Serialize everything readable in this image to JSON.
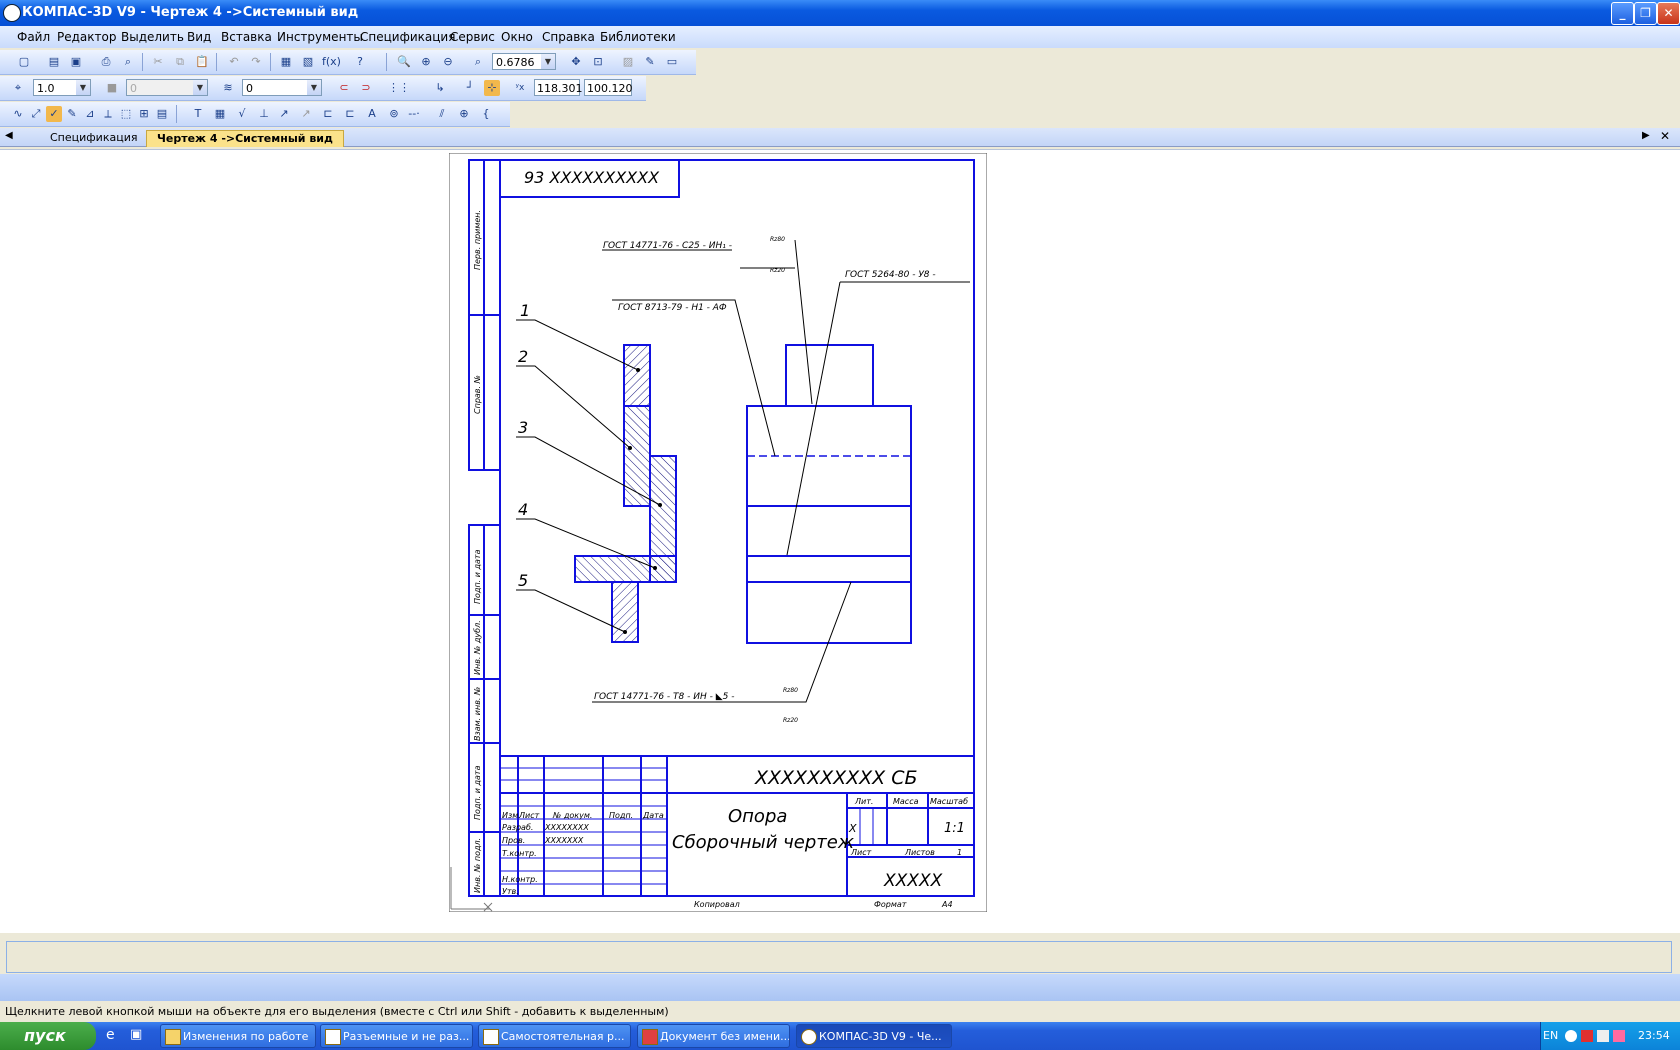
{
  "window": {
    "title": "КОМПАС-3D V9 - Чертеж 4 ->Системный вид"
  },
  "menu": [
    "Файл",
    "Редактор",
    "Выделить",
    "Вид",
    "Вставка",
    "Инструменты",
    "Спецификация",
    "Сервис",
    "Окно",
    "Справка",
    "Библиотеки"
  ],
  "toolbar1": {
    "zoom_value": "0.6786"
  },
  "toolbar2": {
    "step_value": "1.0",
    "style_value": "0",
    "layer_value": "0",
    "coord_x": "118.301",
    "coord_y": "100.120"
  },
  "tabs": [
    {
      "label": "Спецификация",
      "active": false
    },
    {
      "label": "Чертеж 4 ->Системный вид",
      "active": true
    }
  ],
  "drawing": {
    "top_stamp": "93 XXXXXXXXXX",
    "margin_labels": [
      "Перв. примен.",
      "Справ. №",
      "Подп. и дата",
      "Инв. № дубл.",
      "Взам. инв. №",
      "Подп. и дата",
      "Инв. № подл."
    ],
    "callouts": [
      "1",
      "2",
      "3",
      "4",
      "5"
    ],
    "annotation_1": "ГОСТ 14771-76 - С25 - ИН₁ -",
    "annotation_1_num": "Rz80",
    "annotation_1_den": "Rz20",
    "annotation_2": "ГОСТ 8713-79 - Н1 - АФ",
    "annotation_3": "ГОСТ 5264-80 - У8 -",
    "annotation_4": "ГОСТ 14771-76 - Т8 - ИН - ◣5 -",
    "annotation_4_num": "Rz80",
    "annotation_4_den": "Rz20",
    "title_block": {
      "designation": "XXXXXXXXXX СБ",
      "name_line1": "Опора",
      "name_line2": "Сборочный чертеж",
      "col_headers": [
        "Изм.",
        "Лист",
        "№ докум.",
        "Подп.",
        "Дата"
      ],
      "rows": [
        {
          "label": "Разраб.",
          "value": "XXXXXXXX"
        },
        {
          "label": "Пров.",
          "value": "XXXXXXX"
        },
        {
          "label": "Т.контр.",
          "value": ""
        },
        {
          "label": "",
          "value": ""
        },
        {
          "label": "Н.контр.",
          "value": ""
        },
        {
          "label": "Утв.",
          "value": ""
        }
      ],
      "lit_label": "Лит.",
      "mass_label": "Масса",
      "scale_label": "Масштаб",
      "lit_value": "X",
      "scale_value": "1:1",
      "sheet_label": "Лист",
      "sheets_label": "Листов",
      "sheets_value": "1",
      "org": "XXXXX",
      "copied_label": "Копировал",
      "format_label": "Формат",
      "format_value": "A4"
    }
  },
  "status": {
    "hint": "Щелкните левой кнопкой мыши на объекте для его выделения (вместе с Ctrl или Shift - добавить к выделенным)"
  },
  "taskbar": {
    "start_label": "пуск",
    "tasks": [
      {
        "label": "Изменения по работе",
        "active": false
      },
      {
        "label": "Разъемные и не раз...",
        "active": false
      },
      {
        "label": "Самостоятельная р...",
        "active": false
      },
      {
        "label": "Документ без имени...",
        "active": false
      },
      {
        "label": "КОМПАС-3D V9 - Че...",
        "active": true
      }
    ],
    "lang": "EN",
    "clock": "23:54"
  }
}
